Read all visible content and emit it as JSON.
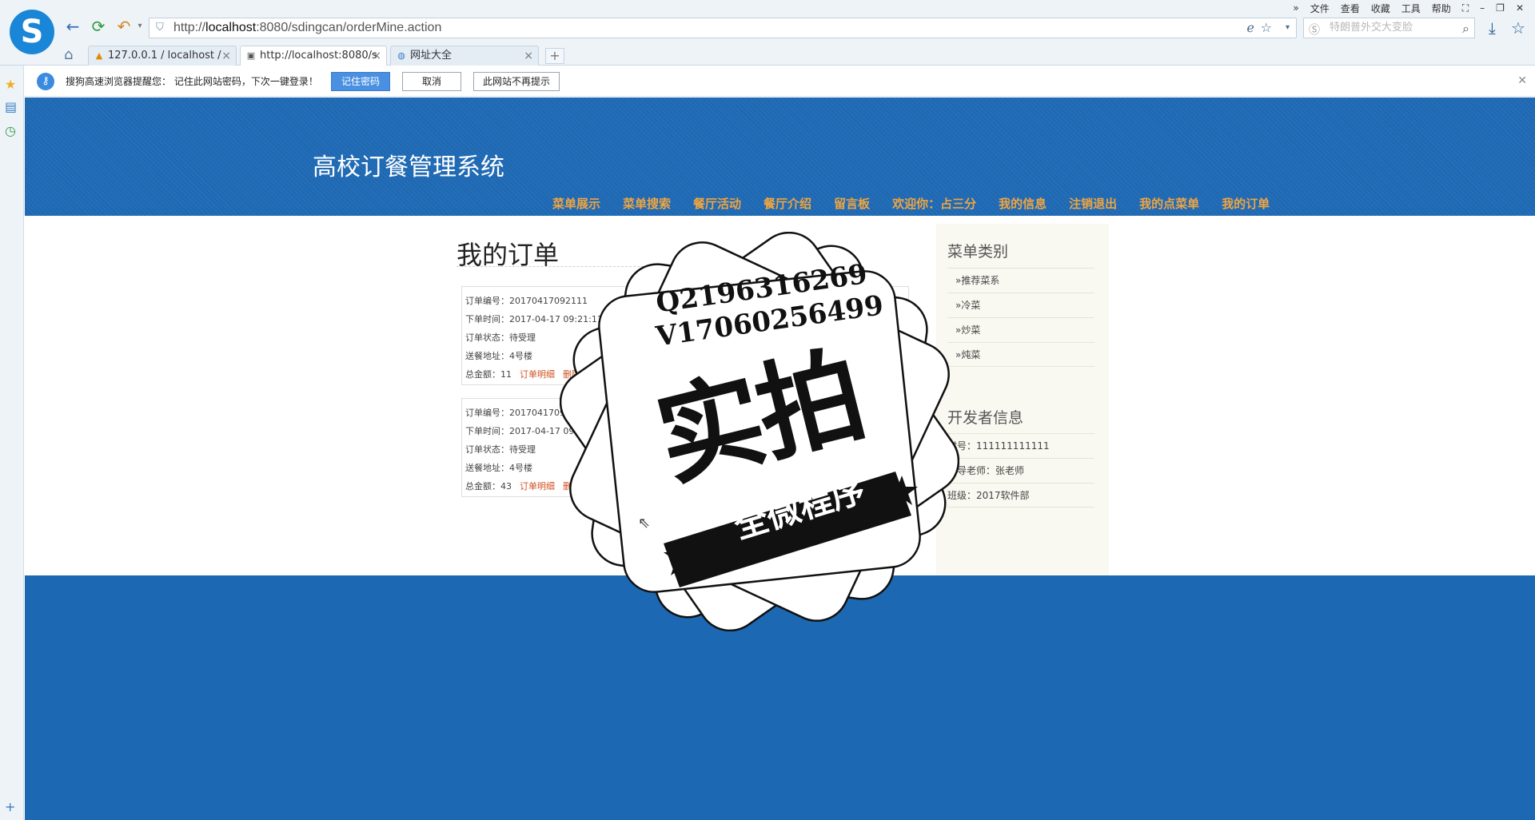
{
  "browser": {
    "url_prefix": "http://",
    "url_host": "localhost",
    "url_rest": ":8080/sdingcan/orderMine.action",
    "search_placeholder": "特朗普外交大变脸",
    "menu": [
      "文件",
      "查看",
      "收藏",
      "工具",
      "帮助"
    ],
    "tabs": [
      {
        "label": "127.0.0.1 / localhost /",
        "active": false
      },
      {
        "label": "http://localhost:8080/s",
        "active": true
      },
      {
        "label": "网址大全",
        "active": false
      }
    ]
  },
  "password_bar": {
    "message": "搜狗高速浏览器提醒您： 记住此网站密码，下次一键登录！",
    "remember": "记住密码",
    "cancel": "取消",
    "never": "此网站不再提示"
  },
  "site": {
    "title": "高校订餐管理系统",
    "nav": [
      "菜单展示",
      "菜单搜索",
      "餐厅活动",
      "餐厅介绍",
      "留言板",
      "欢迎你：占三分",
      "我的信息",
      "注销退出",
      "我的点菜单",
      "我的订单"
    ]
  },
  "main": {
    "heading": "我的订单",
    "orders": [
      {
        "number": "订单编号：20170417092111",
        "time": "下单时间：2017-04-17 09:21:11",
        "status": "订单状态：待受理",
        "address": "送餐地址：4号楼",
        "total": "总金额：11",
        "detail_link": "订单明细",
        "delete_link": "删除"
      },
      {
        "number": "订单编号：20170417093612",
        "time": "下单时间：2017-04-17 09:36:1",
        "status": "订单状态：待受理",
        "address": "送餐地址：4号楼",
        "total": "总金额：43",
        "detail_link": "订单明细",
        "delete_link": "删除"
      }
    ]
  },
  "sidebar": {
    "categories_title": "菜单类别",
    "categories": [
      "»推荐菜系",
      "»冷菜",
      "»炒菜",
      "»炖菜"
    ],
    "dev_title": "开发者信息",
    "dev_items": [
      "学号：111111111111",
      "指导老师：张老师",
      "班级：2017软件部"
    ]
  },
  "footer": {
    "link": "系统后台"
  },
  "watermark": {
    "line1": "Q2196316269",
    "line2": "V17060256499",
    "big": "实拍",
    "ribbon": "全微程序"
  },
  "colors": {
    "header_blue": "#1d68b3",
    "nav_orange": "#f0a540",
    "link_red": "#d05020"
  }
}
